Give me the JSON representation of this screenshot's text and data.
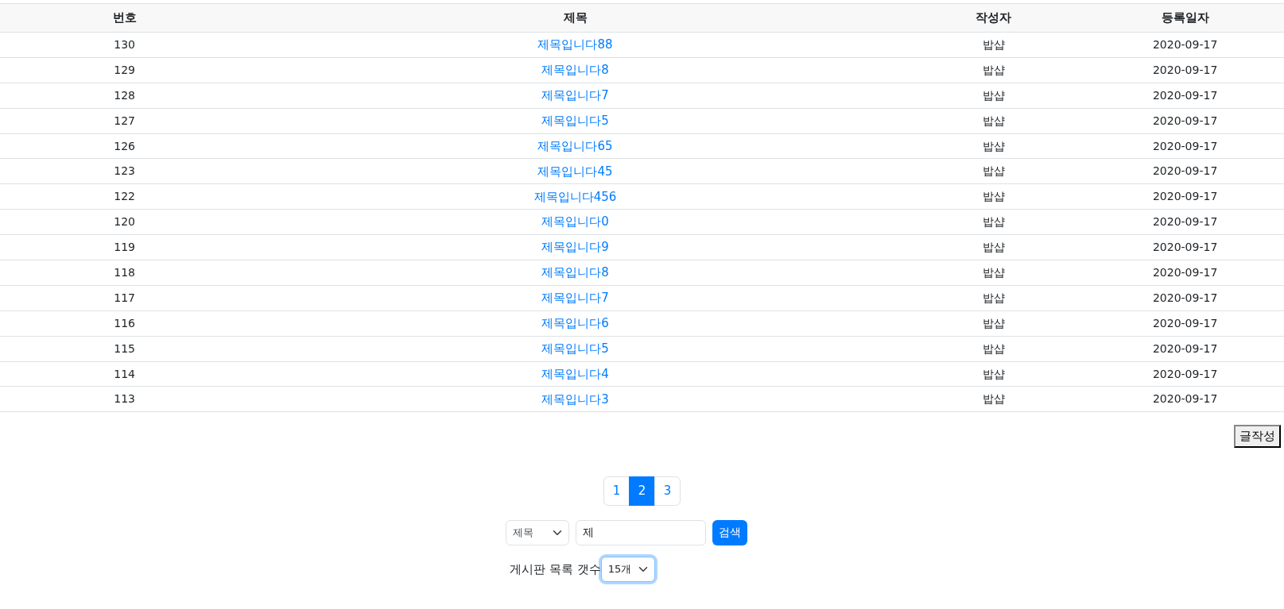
{
  "table": {
    "columns": [
      "번호",
      "제목",
      "작성자",
      "등록일자"
    ],
    "rows": [
      {
        "number": "130",
        "title": "제목입니다88",
        "author": "밥샵",
        "date": "2020-09-17"
      },
      {
        "number": "129",
        "title": "제목입니다8",
        "author": "밥샵",
        "date": "2020-09-17"
      },
      {
        "number": "128",
        "title": "제목입니다7",
        "author": "밥샵",
        "date": "2020-09-17"
      },
      {
        "number": "127",
        "title": "제목입니다5",
        "author": "밥샵",
        "date": "2020-09-17"
      },
      {
        "number": "126",
        "title": "제목입니다65",
        "author": "밥샵",
        "date": "2020-09-17"
      },
      {
        "number": "123",
        "title": "제목입니다45",
        "author": "밥샵",
        "date": "2020-09-17"
      },
      {
        "number": "122",
        "title": "제목입니다456",
        "author": "밥샵",
        "date": "2020-09-17"
      },
      {
        "number": "120",
        "title": "제목입니다0",
        "author": "밥샵",
        "date": "2020-09-17"
      },
      {
        "number": "119",
        "title": "제목입니다9",
        "author": "밥샵",
        "date": "2020-09-17"
      },
      {
        "number": "118",
        "title": "제목입니다8",
        "author": "밥샵",
        "date": "2020-09-17"
      },
      {
        "number": "117",
        "title": "제목입니다7",
        "author": "밥샵",
        "date": "2020-09-17"
      },
      {
        "number": "116",
        "title": "제목입니다6",
        "author": "밥샵",
        "date": "2020-09-17"
      },
      {
        "number": "115",
        "title": "제목입니다5",
        "author": "밥샵",
        "date": "2020-09-17"
      },
      {
        "number": "114",
        "title": "제목입니다4",
        "author": "밥샵",
        "date": "2020-09-17"
      },
      {
        "number": "113",
        "title": "제목입니다3",
        "author": "밥샵",
        "date": "2020-09-17"
      }
    ]
  },
  "write_button": "글작성",
  "pagination": [
    {
      "label": "1",
      "selected": false
    },
    {
      "label": "2",
      "selected": true
    },
    {
      "label": "3",
      "selected": false
    }
  ],
  "search": {
    "field_select": "제목",
    "query": "제",
    "button": "검색"
  },
  "list_count": {
    "label": "게시판 목록 갯수",
    "value": "15개",
    "focused": true
  }
}
